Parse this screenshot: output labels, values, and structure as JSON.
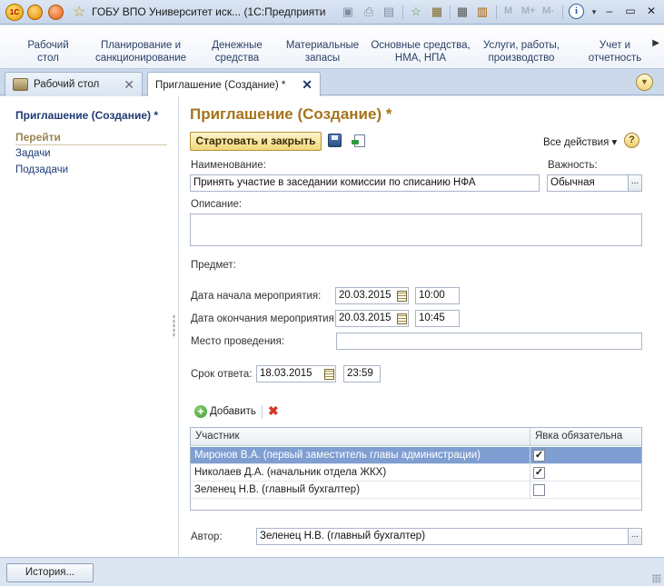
{
  "window": {
    "title": "ГОБУ ВПО Университет иск...  (1С:Предприятие)",
    "logo_text": "1С",
    "toolbar_m": [
      "M",
      "M+",
      "M-"
    ]
  },
  "sections": [
    {
      "line1": "Рабочий",
      "line2": "стол"
    },
    {
      "line1": "Планирование и",
      "line2": "санкционирование"
    },
    {
      "line1": "Денежные",
      "line2": "средства"
    },
    {
      "line1": "Материальные",
      "line2": "запасы"
    },
    {
      "line1": "Основные средства,",
      "line2": "НМА, НПА"
    },
    {
      "line1": "Услуги, работы,",
      "line2": "производство"
    },
    {
      "line1": "Учет и",
      "line2": "отчетность"
    }
  ],
  "tabs": [
    {
      "label": "Рабочий стол"
    },
    {
      "label": "Приглашение (Создание) *"
    }
  ],
  "leftnav": {
    "title": "Приглашение (Создание) *",
    "goto_header": "Перейти",
    "links": [
      "Задачи",
      "Подзадачи"
    ]
  },
  "form": {
    "title": "Приглашение (Создание) *",
    "start_button": "Стартовать и закрыть",
    "all_actions": "Все действия ▾",
    "help": "?",
    "name_label": "Наименование:",
    "name_value": "Принять участие в заседании комиссии по списанию НФА",
    "importance_label": "Важность:",
    "importance_value": "Обычная",
    "description_label": "Описание:",
    "subject_label": "Предмет:",
    "start_date_label": "Дата начала мероприятия:",
    "start_date": "20.03.2015",
    "start_time": "10:00",
    "end_date_label": "Дата окончания мероприятия:",
    "end_date": "20.03.2015",
    "end_time": "10:45",
    "place_label": "Место проведения:",
    "deadline_label": "Срок ответа:",
    "deadline_date": "18.03.2015",
    "deadline_time": "23:59",
    "add_button": "Добавить",
    "author_label": "Автор:",
    "author_value": "Зеленец Н.В. (главный бухгалтер)",
    "ellipsis": "..."
  },
  "participants": {
    "columns": [
      "Участник",
      "Явка обязательна"
    ],
    "rows": [
      {
        "name": "Миронов В.А. (первый заместитель главы администрации)",
        "mandatory": "✓"
      },
      {
        "name": "Николаев Д.А. (начальник отдела ЖКХ)",
        "mandatory": "✓"
      },
      {
        "name": "Зеленец Н.В. (главный бухгалтер)",
        "mandatory": ""
      }
    ]
  },
  "bottom": {
    "history_button": "История..."
  }
}
